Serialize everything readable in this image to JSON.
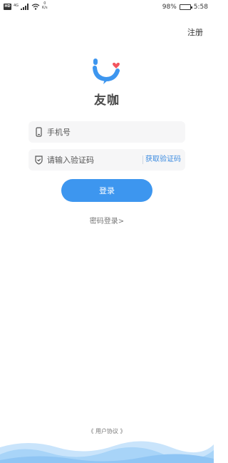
{
  "status_bar": {
    "hd": "HD",
    "net": "4G",
    "speed_value": "0",
    "speed_unit": "K/s",
    "battery": "98%",
    "battery_level": 0.98,
    "time": "5:58"
  },
  "header": {
    "register_label": "注册"
  },
  "brand": {
    "name": "友咖"
  },
  "form": {
    "phone_placeholder": "手机号",
    "code_placeholder": "请输入验证码",
    "get_code_label": "获取验证码",
    "login_label": "登录"
  },
  "links": {
    "password_login": "密码登录>",
    "user_agreement": "《 用户协议 》"
  },
  "colors": {
    "accent": "#3d96ef",
    "brand_heart": "#f2555e",
    "wave_light": "#c9e4fb",
    "wave_dark": "#8fc5f4"
  },
  "icons": {
    "phone": "mobile-phone-icon",
    "code": "shield-check-icon",
    "logo": "smile-heart-logo"
  }
}
